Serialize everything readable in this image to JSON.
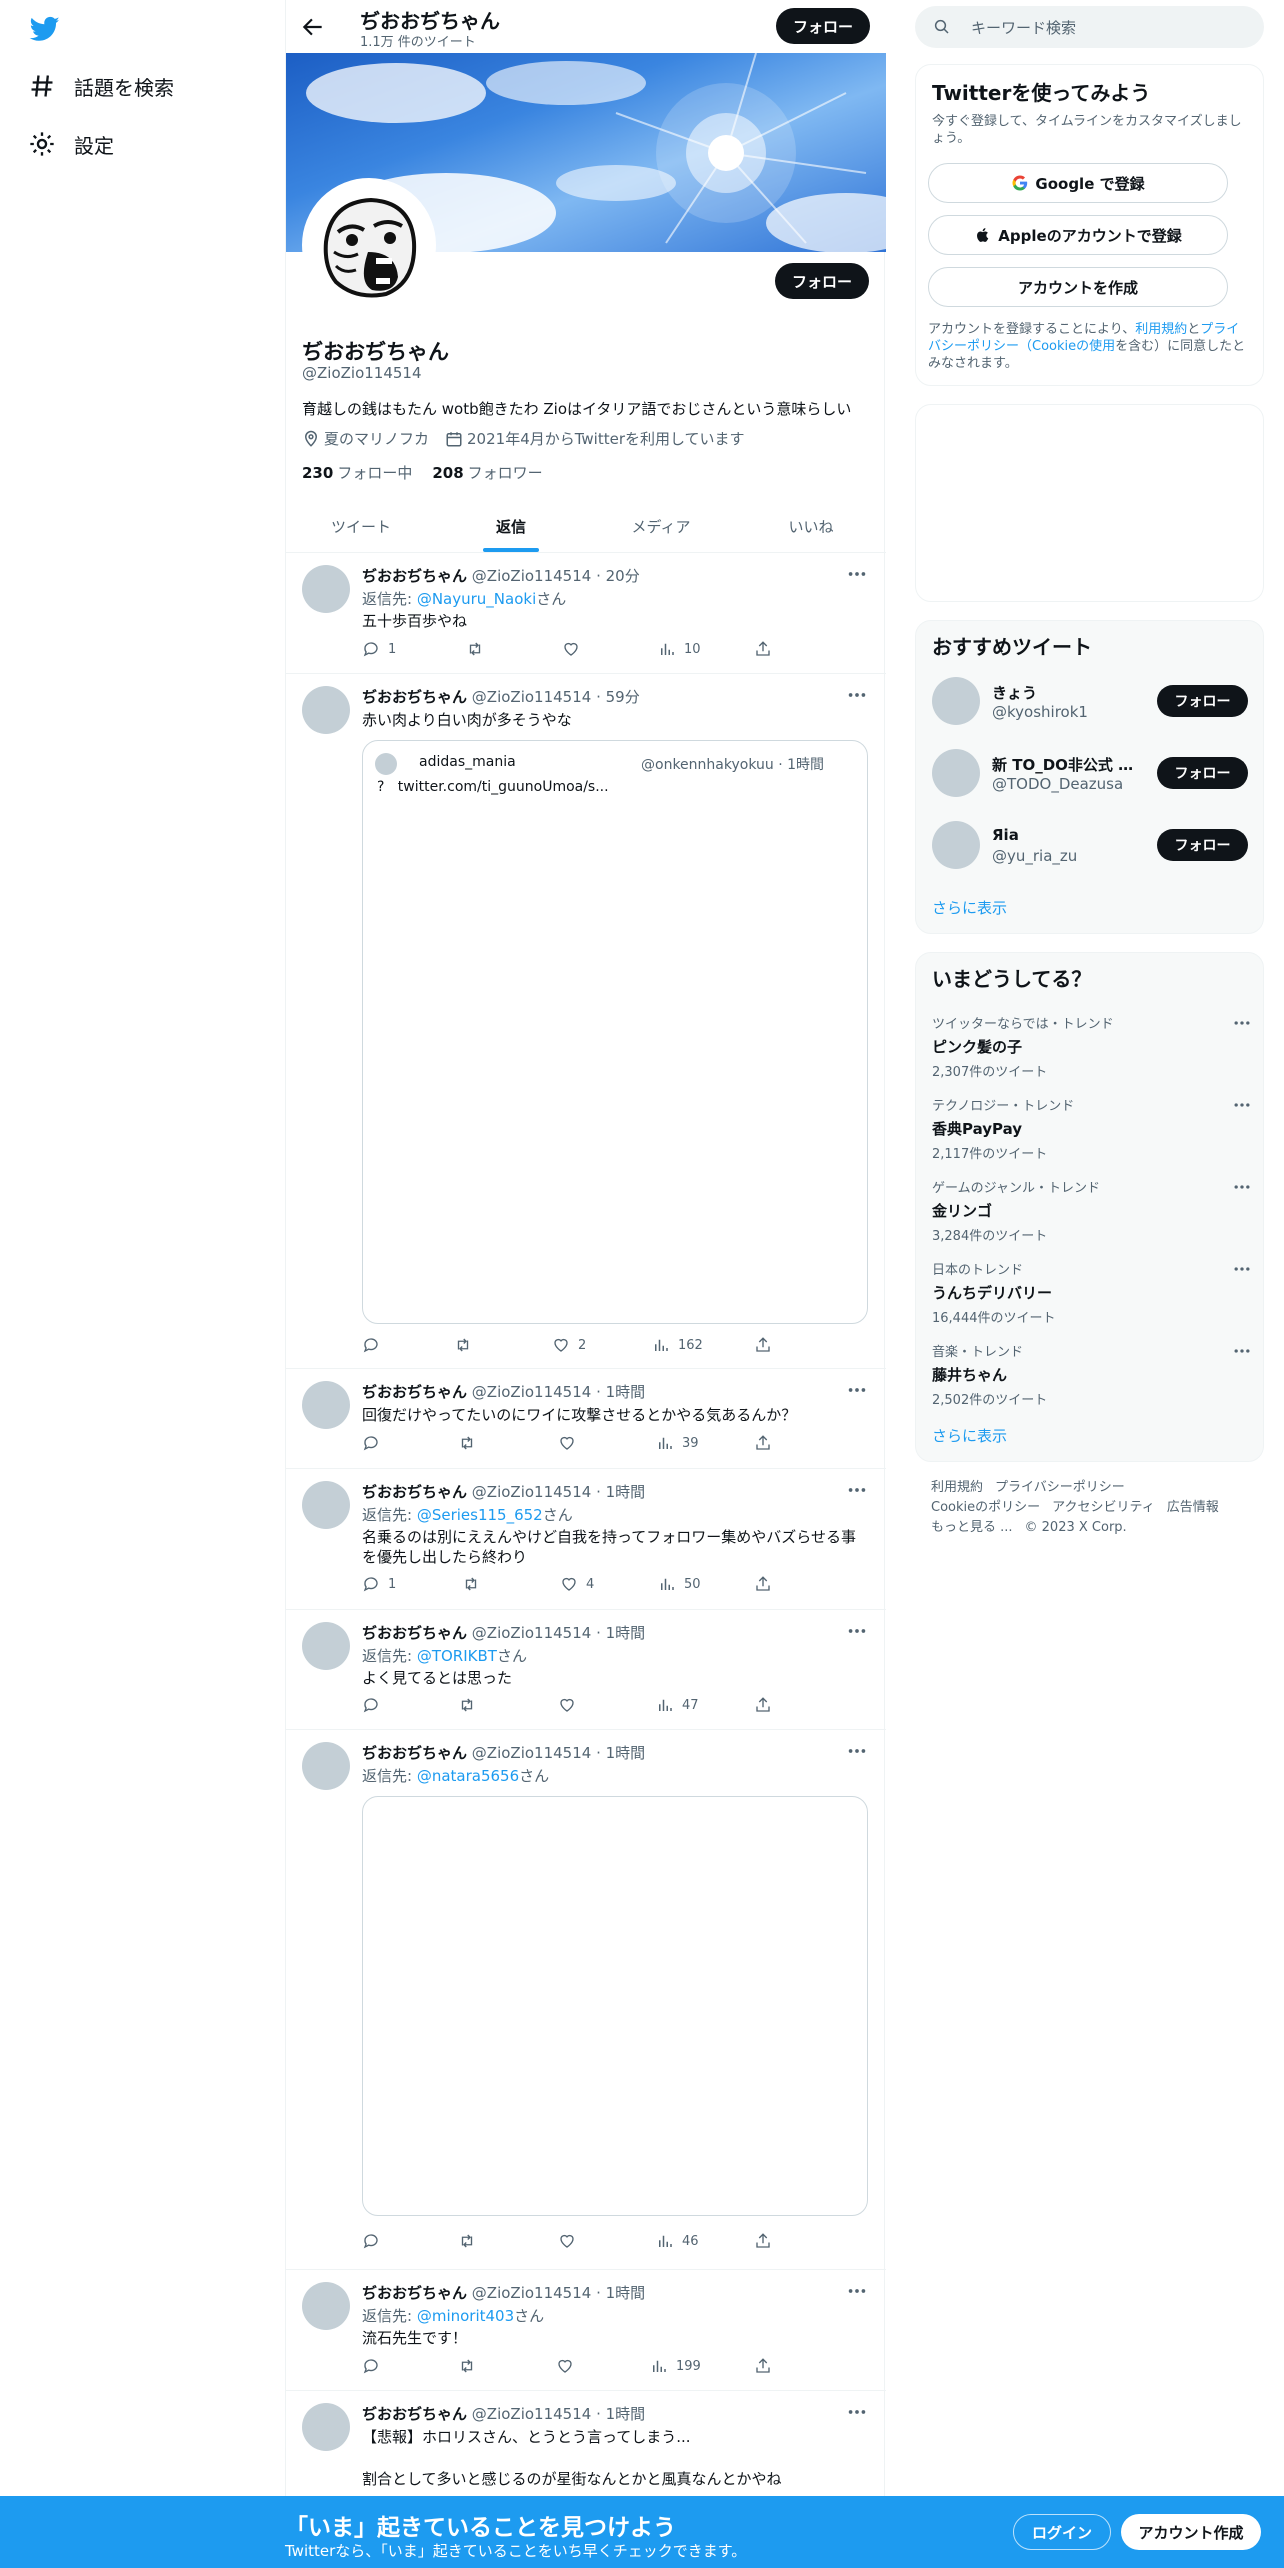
{
  "nav": {
    "explore_label": "話題を検索",
    "settings_label": "設定"
  },
  "header": {
    "name": "ぢおおぢちゃん",
    "tweet_count": "1.1万 件のツイート",
    "follow_label": "フォロー"
  },
  "profile": {
    "name": "ぢおおぢちゃん",
    "handle": "@ZioZio114514",
    "bio": "育越しの銭はもたん wotb飽きたわ Zioはイタリア語でおじさんという意味らしい",
    "location": "夏のマリノフカ",
    "joined": "2021年4月からTwitterを利用しています",
    "following_count": "230",
    "following_label": "フォロー中",
    "followers_count": "208",
    "followers_label": "フォロワー",
    "follow_label": "フォロー"
  },
  "tabs": [
    "ツイート",
    "返信",
    "メディア",
    "いいね"
  ],
  "tweets": [
    {
      "name": "ぢおおぢちゃん",
      "handle": "@ZioZio114514",
      "time": "20分",
      "reply_prefix": "返信先: ",
      "reply_to": "@Nayuru_Naoki",
      "reply_suffix": "さん",
      "text": "五十歩百歩やね",
      "replies": "1",
      "retweets": "",
      "likes": "",
      "views": "10"
    },
    {
      "name": "ぢおおぢちゃん",
      "handle": "@ZioZio114514",
      "time": "59分",
      "text": "赤い肉より白い肉が多そうやな",
      "quote": {
        "name": "adidas_mania",
        "handle": "@onkennhakyokuu",
        "time": "1時間",
        "text": "twitter.com/ti_guunoUmoa/s..."
      },
      "replies": "",
      "retweets": "",
      "likes": "2",
      "views": "162"
    },
    {
      "name": "ぢおおぢちゃん",
      "handle": "@ZioZio114514",
      "time": "1時間",
      "text": "回復だけやってたいのにワイに攻撃させるとかやる気あるんか？",
      "replies": "",
      "retweets": "",
      "likes": "",
      "views": "39"
    },
    {
      "name": "ぢおおぢちゃん",
      "handle": "@ZioZio114514",
      "time": "1時間",
      "reply_prefix": "返信先: ",
      "reply_to": "@Series115_652",
      "reply_suffix": "さん",
      "text": "名乗るのは別にええんやけど自我を持ってフォロワー集めやバズらせる事",
      "text2": "を優先し出したら終わり",
      "replies": "1",
      "retweets": "",
      "likes": "4",
      "views": "50"
    },
    {
      "name": "ぢおおぢちゃん",
      "handle": "@ZioZio114514",
      "time": "1時間",
      "reply_prefix": "返信先: ",
      "reply_to": "@TORIKBT",
      "reply_suffix": "さん",
      "text": "よく見てるとは思った",
      "replies": "",
      "retweets": "",
      "likes": "",
      "views": "47"
    },
    {
      "name": "ぢおおぢちゃん",
      "handle": "@ZioZio114514",
      "time": "1時間",
      "reply_prefix": "返信先: ",
      "reply_to": "@natara5656",
      "reply_suffix": "さん",
      "replies": "",
      "retweets": "",
      "likes": "",
      "views": "46"
    },
    {
      "name": "ぢおおぢちゃん",
      "handle": "@ZioZio114514",
      "time": "1時間",
      "reply_prefix": "返信先: ",
      "reply_to": "@minorit403",
      "reply_suffix": "さん",
      "text": "流石先生です！",
      "replies": "",
      "retweets": "",
      "likes": "",
      "views": "199"
    },
    {
      "name": "ぢおおぢちゃん",
      "handle": "@ZioZio114514",
      "time": "1時間",
      "text": "【悲報】ホロリスさん、とうとう言ってしまう...",
      "text2": "割合として多いと感じるのが星街なんとかと風真なんとかやね"
    }
  ],
  "sidebar": {
    "search_placeholder": "キーワード検索",
    "signup": {
      "title": "Twitterを使ってみよう",
      "desc": "今すぐ登録して、タイムラインをカスタマイズしましょう。",
      "google": "Google で登録",
      "apple": "Appleのアカウントで登録",
      "create": "アカウントを作成",
      "terms_1": "アカウントを登録することにより、",
      "terms_link1": "利用規約",
      "terms_2": "と",
      "terms_link2": "プライバシーポリシー（Cookieの使用",
      "terms_3": "を含む）に同意したとみなされます。"
    },
    "recommended": {
      "title": "おすすめツイート",
      "users": [
        {
          "name": "きょう",
          "handle": "@kyoshirok1",
          "follow": "フォロー"
        },
        {
          "name": "新 TO_DO非公式 河...",
          "handle": "@TODO_Deazusa",
          "follow": "フォロー"
        },
        {
          "name": "Яia",
          "handle": "@yu_ria_zu",
          "follow": "フォロー"
        }
      ],
      "more": "さらに表示"
    },
    "trends": {
      "title": "いまどうしてる？",
      "items": [
        {
          "category": "ツイッターならでは・トレンド",
          "title": "ピンク髪の子",
          "count": "2,307件のツイート"
        },
        {
          "category": "テクノロジー・トレンド",
          "title": "香典PayPay",
          "count": "2,117件のツイート"
        },
        {
          "category": "ゲームのジャンル・トレンド",
          "title": "金リンゴ",
          "count": "3,284件のツイート"
        },
        {
          "category": "日本のトレンド",
          "title": "うんちデリバリー",
          "count": "16,444件のツイート"
        },
        {
          "category": "音楽・トレンド",
          "title": "藤井ちゃん",
          "count": "2,502件のツイート"
        }
      ],
      "more": "さらに表示"
    },
    "footer": [
      "利用規約",
      "プライバシーポリシー",
      "Cookieのポリシー",
      "アクセシビリティ",
      "広告情報",
      "もっと見る ...",
      "© 2023 X Corp."
    ]
  },
  "bottom_bar": {
    "title": "「いま」起きていることを見つけよう",
    "subtitle": "Twitterなら、「いま」起きていることをいち早くチェックできます。",
    "login": "ログイン",
    "signup": "アカウント作成"
  },
  "colors": {
    "accent": "#1d9bf0",
    "text": "#0f1419",
    "muted": "#536471"
  }
}
